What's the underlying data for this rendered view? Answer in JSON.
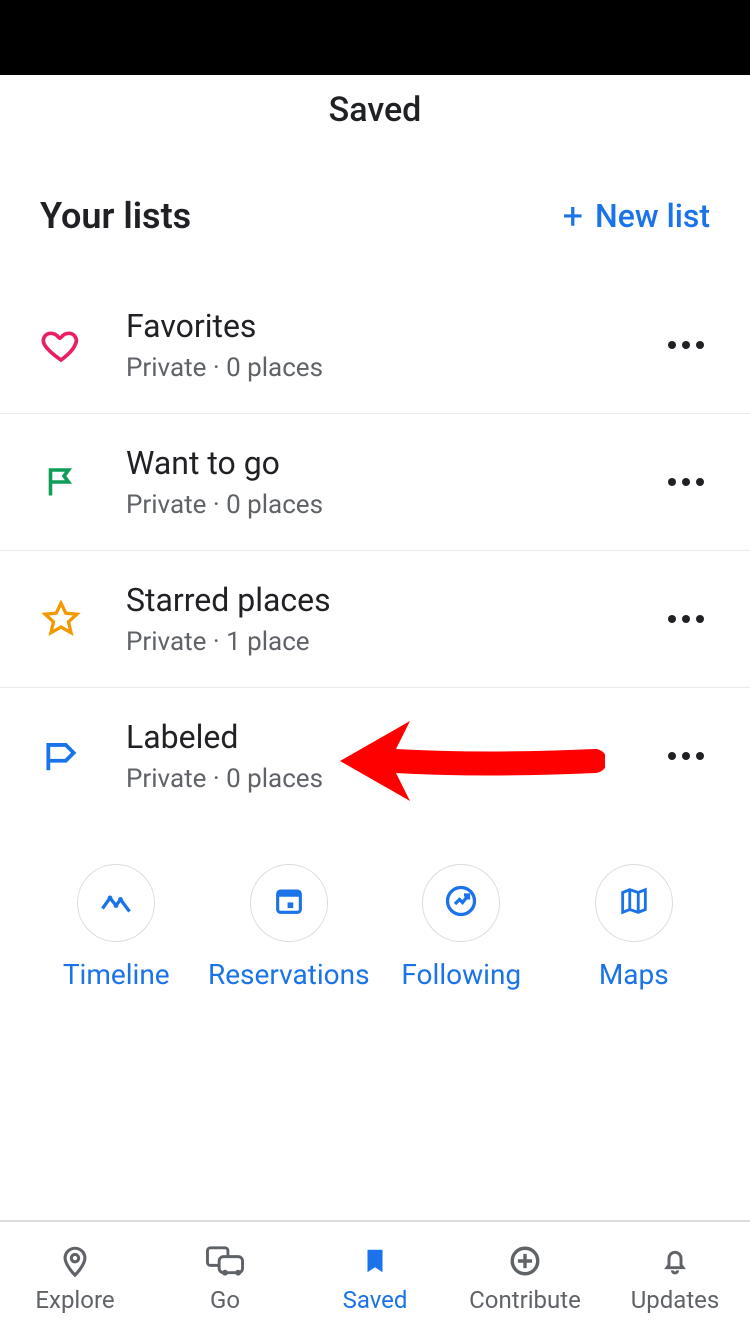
{
  "header": {
    "title": "Saved"
  },
  "section": {
    "title": "Your lists",
    "new_list_label": "New list"
  },
  "lists": [
    {
      "name": "Favorites",
      "sub": "Private · 0 places",
      "icon": "heart"
    },
    {
      "name": "Want to go",
      "sub": "Private · 0 places",
      "icon": "flag"
    },
    {
      "name": "Starred places",
      "sub": "Private · 1 place",
      "icon": "star"
    },
    {
      "name": "Labeled",
      "sub": "Private · 0 places",
      "icon": "label"
    }
  ],
  "quick": [
    {
      "label": "Timeline",
      "icon": "timeline"
    },
    {
      "label": "Reservations",
      "icon": "calendar"
    },
    {
      "label": "Following",
      "icon": "following"
    },
    {
      "label": "Maps",
      "icon": "maps"
    }
  ],
  "tabs": [
    {
      "label": "Explore",
      "icon": "pin",
      "active": false
    },
    {
      "label": "Go",
      "icon": "commute",
      "active": false
    },
    {
      "label": "Saved",
      "icon": "bookmark",
      "active": true
    },
    {
      "label": "Contribute",
      "icon": "add-circle",
      "active": false
    },
    {
      "label": "Updates",
      "icon": "bell",
      "active": false
    }
  ],
  "colors": {
    "accent": "#1a73e8",
    "heart": "#e91e63",
    "flag": "#0f9d58",
    "star": "#f29900",
    "label": "#1a73e8",
    "arrow": "#ff0000"
  }
}
